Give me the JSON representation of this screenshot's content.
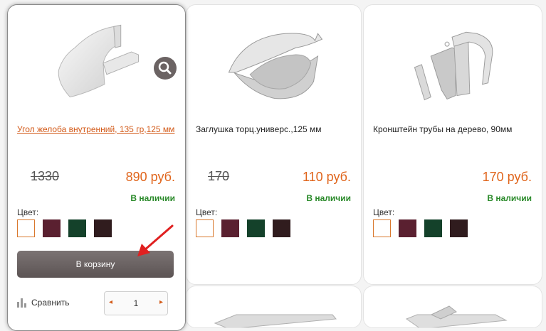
{
  "products": [
    {
      "title": "Угол желоба внутренний, 135 гр,125 мм",
      "old_price": "1330",
      "price": "890 руб.",
      "stock": "В наличии",
      "color_label": "Цвет:",
      "colors": [
        "#ffffff",
        "#5a2030",
        "#14412a",
        "#301c1e"
      ]
    },
    {
      "title": "Заглушка торц.универс.,125 мм",
      "old_price": "170",
      "price": "110 руб.",
      "stock": "В наличии",
      "color_label": "Цвет:",
      "colors": [
        "#ffffff",
        "#5a2030",
        "#14412a",
        "#301c1e"
      ]
    },
    {
      "title": "Кронштейн трубы на дерево, 90мм",
      "old_price": "",
      "price": "170 руб.",
      "stock": "В наличии",
      "color_label": "Цвет:",
      "colors": [
        "#ffffff",
        "#5a2030",
        "#14412a",
        "#301c1e"
      ]
    }
  ],
  "cart_button": "В корзину",
  "compare_label": "Сравнить",
  "quantity": "1",
  "stepper_minus": "◂",
  "stepper_plus": "▸",
  "accent_color": "#e0651c",
  "stock_color": "#2a8a2a"
}
